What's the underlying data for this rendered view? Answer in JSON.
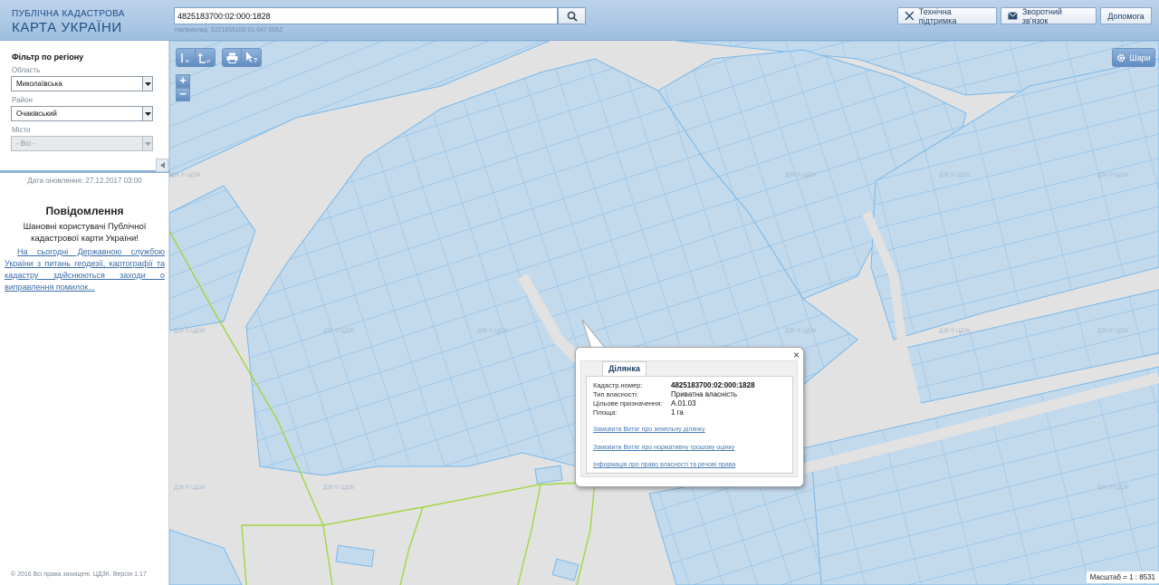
{
  "header": {
    "logo_line1": "ПУБЛІЧНА КАДАСТРОВА",
    "logo_line2": "КАРТА УКРАЇНИ",
    "search_value": "4825183700:02:000:1828",
    "search_hint": "Наприклад: 3221655100:01:047:0052",
    "tech_support": "Технічна підтримка",
    "feedback": "Зворотний зв'язок",
    "help": "Допомога"
  },
  "filter": {
    "title": "Фільтр по регіону",
    "region_label": "Область",
    "region_value": "Миколаївська",
    "district_label": "Район",
    "district_value": "Очаківський",
    "city_label": "Місто",
    "city_value": "- Всі -"
  },
  "sidebar": {
    "update_date": "Дата оновлення: 27.12.2017 03:00",
    "notice_title": "Повідомлення",
    "notice_text": "Шановні користувачі Публічної кадастрової карти України!",
    "notice_link": "На сьогодні Державною службою України з питань геодезії, картографії та кадастру здійснюються заходи о виправлення помилок...",
    "copyright": "© 2016 Всі права захищені. ЦДЗК. Версія 1.17"
  },
  "map": {
    "zoom_in": "+",
    "zoom_out": "−",
    "layers": "Шари",
    "scale": "Масштаб = 1 : 8531",
    "watermark": "ДЗК © ЦДЗК",
    "colors": {
      "parcel_fill": "#c3d9ec",
      "parcel_stroke": "#79b9e8",
      "road": "#e2e2e2",
      "boundary": "#a2d640"
    }
  },
  "popup": {
    "tab": "Ділянка",
    "close": "×",
    "rows": [
      {
        "label": "Кадастр.номер:",
        "value": "4825183700:02:000:1828"
      },
      {
        "label": "Тип власності:",
        "value": "Приватна власність"
      },
      {
        "label": "Цільове призначення:",
        "value": "A.01.03"
      },
      {
        "label": "Площа:",
        "value": "1 га"
      }
    ],
    "links": [
      "Замовити Витяг про земельну ділянку",
      "Замовити Витяг про нормативну грошову оцінку",
      "Інформація про право власності та речові права"
    ]
  }
}
